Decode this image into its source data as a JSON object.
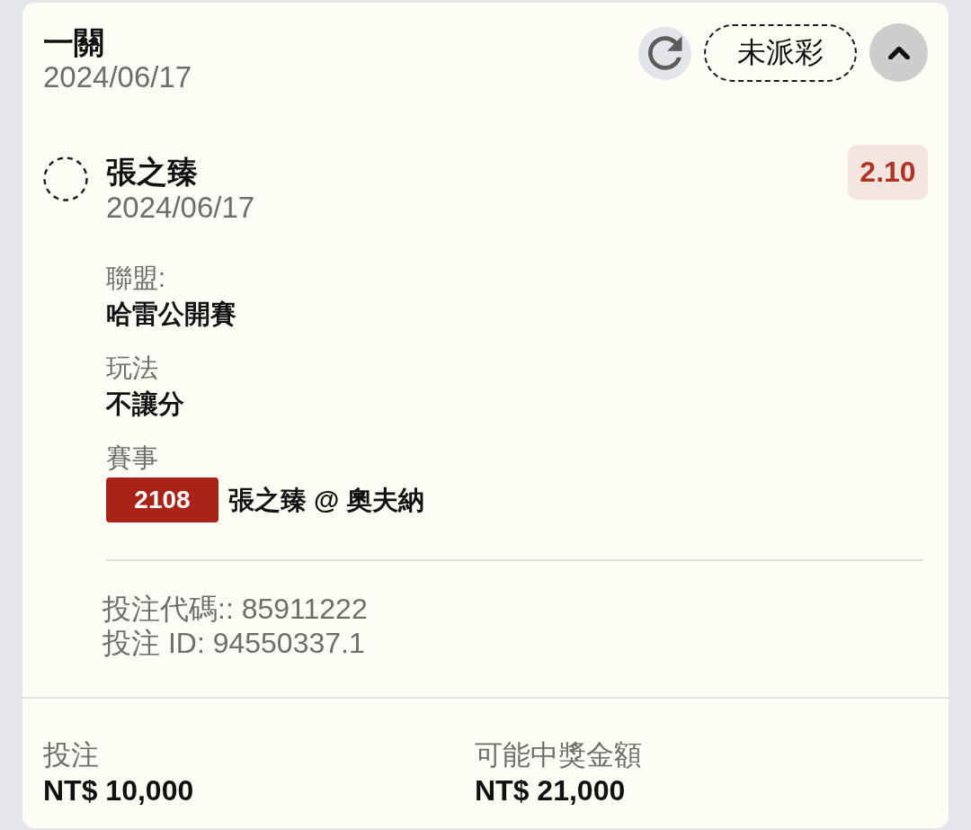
{
  "bet": {
    "type": "一關",
    "date": "2024/06/17",
    "status": "未派彩",
    "expanded": true
  },
  "selection": {
    "name": "張之臻",
    "date": "2024/06/17",
    "odds": "2.10"
  },
  "details": [
    {
      "kind": "text",
      "label": "聯盟:",
      "value": "哈雷公開賽"
    },
    {
      "kind": "text",
      "label": "玩法",
      "value": "不讓分"
    },
    {
      "kind": "event",
      "label": "賽事",
      "event_number": "2108",
      "value": "張之臻 @ 奧夫納"
    }
  ],
  "references": [
    "投注代碼:: 85911222",
    "投注 ID: 94550337.1"
  ],
  "summary": [
    {
      "label": "投注",
      "value": "NT$ 10,000"
    },
    {
      "label": "可能中獎金額",
      "value": "NT$ 21,000"
    }
  ]
}
